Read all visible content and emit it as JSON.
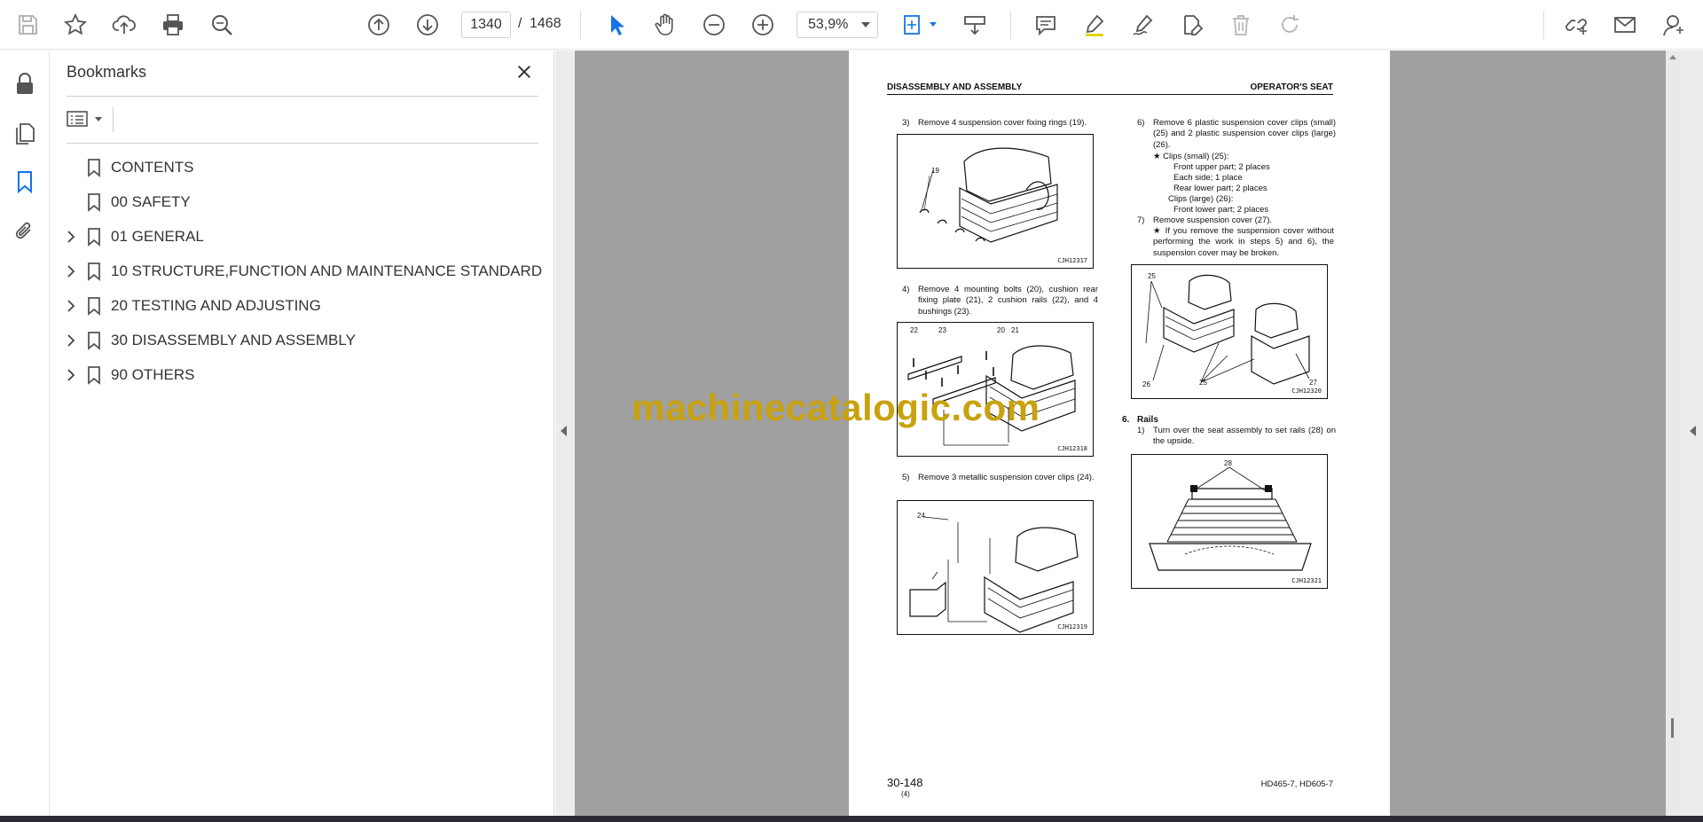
{
  "toolbar": {
    "page_current": "1340",
    "page_separator": "/",
    "page_total": "1468",
    "zoom": "53,9%",
    "icons": [
      "save-icon",
      "star-icon",
      "upload-icon",
      "print-icon",
      "zoom-search-icon",
      "prev-page-icon",
      "next-page-icon",
      "select-cursor-icon",
      "hand-icon",
      "zoom-out-icon",
      "zoom-in-icon",
      "zoom-dropdown-icon",
      "fit-page-icon",
      "scroll-mode-icon",
      "comment-icon",
      "highlight-icon",
      "sign-icon",
      "edit-icon",
      "delete-icon",
      "redo-icon",
      "share-link-icon",
      "email-icon",
      "account-icon"
    ]
  },
  "rail": {
    "icons": [
      "lock-icon",
      "pages-icon",
      "bookmark-icon",
      "attachment-icon"
    ]
  },
  "bookmarks_panel": {
    "title": "Bookmarks",
    "items": [
      {
        "label": "CONTENTS",
        "expandable": false
      },
      {
        "label": "00 SAFETY",
        "expandable": false
      },
      {
        "label": "01 GENERAL",
        "expandable": true
      },
      {
        "label": "10 STRUCTURE,FUNCTION AND MAINTENANCE STANDARD",
        "expandable": true
      },
      {
        "label": "20 TESTING AND ADJUSTING",
        "expandable": true
      },
      {
        "label": "30 DISASSEMBLY AND ASSEMBLY",
        "expandable": true
      },
      {
        "label": "90 OTHERS",
        "expandable": true
      }
    ]
  },
  "page": {
    "header_left": "DISASSEMBLY AND ASSEMBLY",
    "header_right": "OPERATOR'S SEAT",
    "steps_left": [
      {
        "num": "3)",
        "text": "Remove 4 suspension cover fixing rings (19)."
      },
      {
        "num": "4)",
        "text": "Remove 4 mounting bolts (20), cushion rear fixing plate (21), 2 cushion rails (22), and 4 bushings (23)."
      },
      {
        "num": "5)",
        "text": "Remove 3 metallic suspension cover clips (24)."
      }
    ],
    "steps_right": {
      "step6": {
        "num": "6)",
        "text": "Remove 6 plastic suspension cover clips (small) (25) and 2 plastic suspension cover clips (large) (26)."
      },
      "note6": [
        "★  Clips (small) (25):",
        "Front upper part; 2 places",
        "Each side; 1 place",
        "Rear lower part; 2 places",
        "Clips (large) (26):",
        "Front lower part; 2 places"
      ],
      "step7": {
        "num": "7)",
        "text": "Remove suspension cover (27)."
      },
      "note7": "★  If you remove the suspension cover without performing the work in steps 5) and 6), the suspension cover may be broken."
    },
    "section6": {
      "num": "6.",
      "title": "Rails"
    },
    "section6_step1": {
      "num": "1)",
      "text": "Turn over the seat assembly to set rails (28) on the upside."
    },
    "figures": [
      {
        "code": "CJH12317",
        "labels": [
          "19"
        ]
      },
      {
        "code": "CJH12318",
        "labels": [
          "22",
          "23",
          "20",
          "21"
        ]
      },
      {
        "code": "CJH12319",
        "labels": [
          "24"
        ]
      },
      {
        "code": "CJH12320",
        "labels": [
          "25",
          "26",
          "25",
          "27"
        ]
      },
      {
        "code": "CJH12321",
        "labels": [
          "28"
        ]
      }
    ],
    "footer_left": "30-148",
    "footer_sub": "(4)",
    "footer_right": "HD465-7, HD605-7"
  },
  "watermark": "machinecatalogic.com",
  "colors": {
    "accent": "#1473e6",
    "doc_background": "#a0a0a0",
    "watermark": "#c8a20f"
  }
}
